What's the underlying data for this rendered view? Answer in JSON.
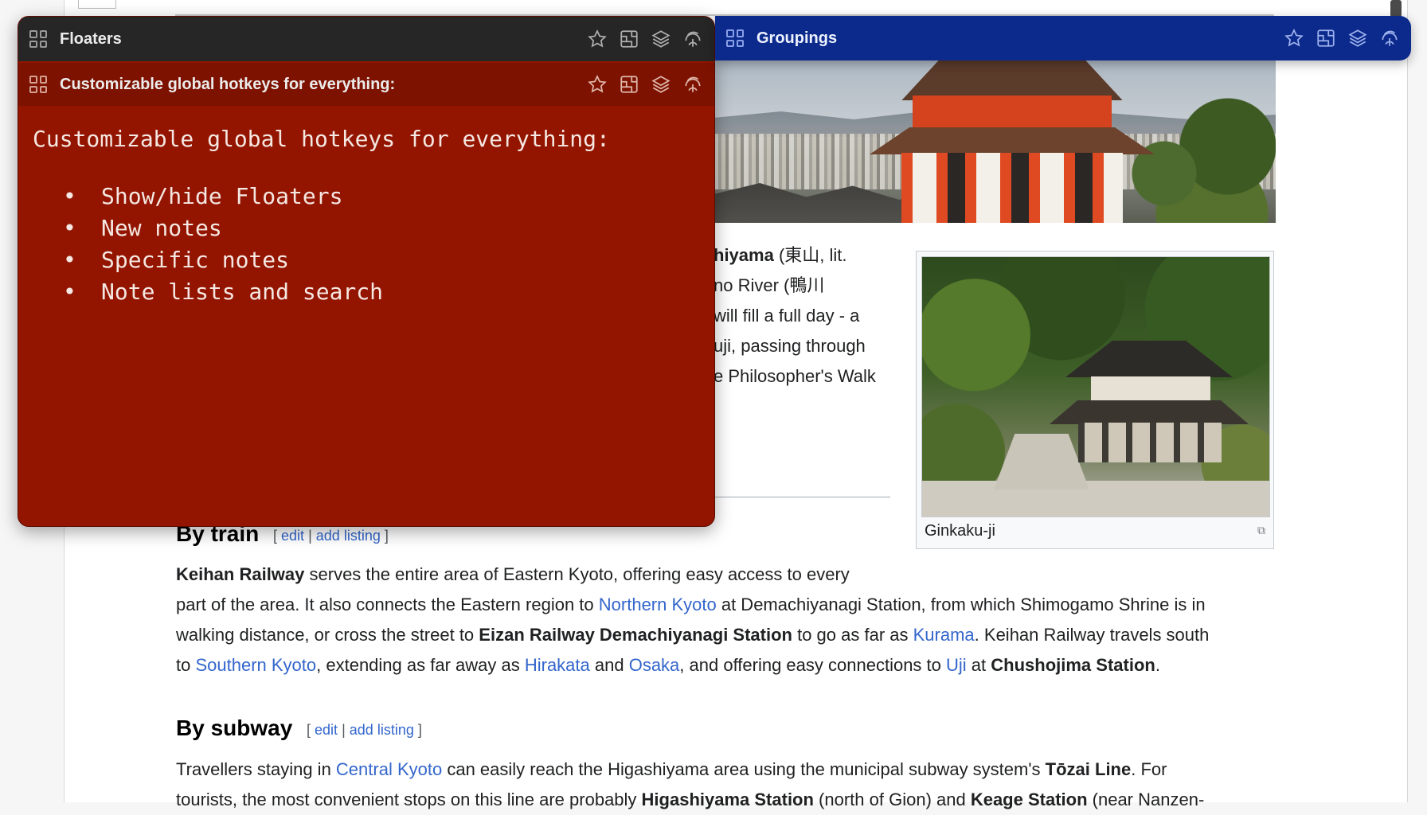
{
  "floaters_window": {
    "title": "Floaters",
    "note_title": "Customizable global hotkeys for everything:",
    "note_heading": "Customizable global hotkeys for everything:",
    "bullet": "•",
    "note_items": [
      "Show/hide Floaters",
      "New notes",
      "Specific notes",
      "Note lists and search"
    ]
  },
  "groupings_window": {
    "title": "Groupings"
  },
  "icons": {
    "grid": "grid-icon",
    "favorite": "star-icon",
    "transparency": "transparency-icon",
    "layers": "layers-icon",
    "fingerprint": "fingerprint-icon"
  },
  "colors": {
    "floater_title_bg": "#262626",
    "floater_note_bg": "#931500",
    "groupings_bg": "#0b2a8c",
    "link": "#3366cc"
  },
  "article": {
    "partial_lines": {
      "l1_bold": "hiyama",
      "l1_rest": " (東山, lit.",
      "l2": "no River (鴨川",
      "l3": "will fill a full day - a",
      "l4": "uji, passing through",
      "l5": "e Philosopher's Walk"
    },
    "thumb_caption": "Ginkaku-ji",
    "by_train": {
      "heading": "By train",
      "edit": "edit",
      "sep": "|",
      "add_listing": "add listing",
      "bracket_open": "[",
      "bracket_close": "]",
      "p1_bold": "Keihan Railway",
      "p1_rest": " serves the entire area of Eastern Kyoto, offering easy access to every",
      "p2_a": "part of the area. It also connects the Eastern region to ",
      "p2_link": "Northern Kyoto",
      "p2_b": " at Demachiyanagi Station, from which Shimogamo Shrine is in",
      "p3_a": "walking distance, or cross the street to ",
      "p3_bold": "Eizan Railway Demachiyanagi Station",
      "p3_b": " to go as far as ",
      "p3_link": "Kurama",
      "p3_c": ". Keihan Railway travels south",
      "p4_a": "to ",
      "p4_link1": "Southern Kyoto",
      "p4_b": ", extending as far away as ",
      "p4_link2": "Hirakata",
      "p4_c": " and ",
      "p4_link3": "Osaka",
      "p4_d": ", and offering easy connections to ",
      "p4_link4": "Uji",
      "p4_e": " at ",
      "p4_bold": "Chushojima Station",
      "p4_f": "."
    },
    "by_subway": {
      "heading": "By subway",
      "edit": "edit",
      "sep": "|",
      "add_listing": "add listing",
      "bracket_open": "[",
      "bracket_close": "]",
      "p1_a": "Travellers staying in ",
      "p1_link": "Central Kyoto",
      "p1_b": " can easily reach the Higashiyama area using the municipal subway system's ",
      "p1_bold": "Tōzai Line",
      "p1_c": ". For",
      "p2_a": "tourists, the most convenient stops on this line are probably ",
      "p2_bold1": "Higashiyama Station",
      "p2_b": " (north of Gion) and ",
      "p2_bold2": "Keage Station",
      "p2_c": " (near Nanzen-"
    }
  }
}
